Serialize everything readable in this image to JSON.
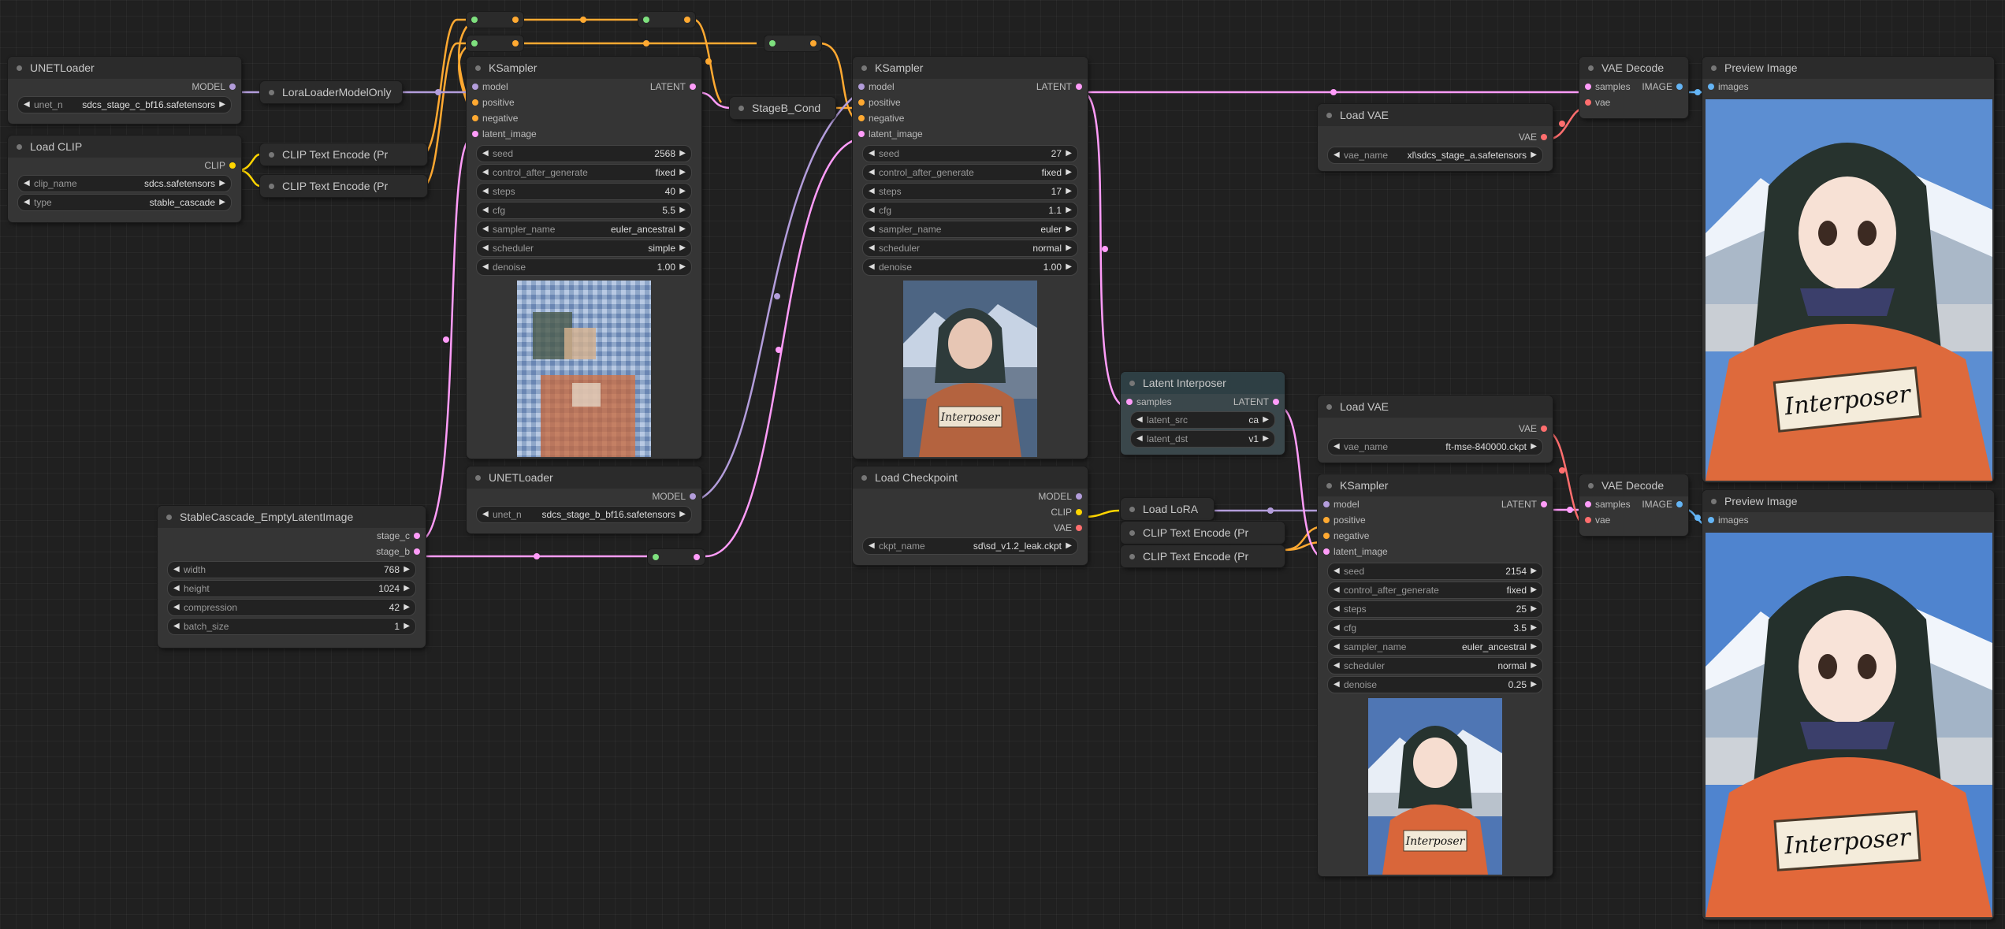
{
  "colors": {
    "model": "#b39ddb",
    "clip": "#ffd500",
    "conditioning": "#ffa931",
    "latent": "#ff9cf9",
    "vae": "#ff6e6e",
    "image": "#64b5f6",
    "float": "#aaaaaa"
  },
  "nodes": {
    "unet1": {
      "title": "UNETLoader",
      "out_model": "MODEL",
      "w_unet_label": "unet_n",
      "w_unet_value": "sdcs_stage_c_bf16.safetensors"
    },
    "loadclip": {
      "title": "Load CLIP",
      "out_clip": "CLIP",
      "w_clip_label": "clip_name",
      "w_clip_value": "sdcs.safetensors",
      "w_type_label": "type",
      "w_type_value": "stable_cascade"
    },
    "lora_model_only": {
      "title": "LoraLoaderModelOnly"
    },
    "clip_enc1": {
      "title": "CLIP Text Encode (Pr"
    },
    "clip_enc2": {
      "title": "CLIP Text Encode (Pr"
    },
    "ks1": {
      "title": "KSampler",
      "in": [
        "model",
        "positive",
        "negative",
        "latent_image"
      ],
      "out_latent": "LATENT",
      "widgets": [
        {
          "label": "seed",
          "value": "2568"
        },
        {
          "label": "control_after_generate",
          "value": "fixed"
        },
        {
          "label": "steps",
          "value": "40"
        },
        {
          "label": "cfg",
          "value": "5.5"
        },
        {
          "label": "sampler_name",
          "value": "euler_ancestral"
        },
        {
          "label": "scheduler",
          "value": "simple"
        },
        {
          "label": "denoise",
          "value": "1.00"
        }
      ]
    },
    "stageb_cond": {
      "title": "StageB_Cond"
    },
    "ks2": {
      "title": "KSampler",
      "in": [
        "model",
        "positive",
        "negative",
        "latent_image"
      ],
      "out_latent": "LATENT",
      "widgets": [
        {
          "label": "seed",
          "value": "27"
        },
        {
          "label": "control_after_generate",
          "value": "fixed"
        },
        {
          "label": "steps",
          "value": "17"
        },
        {
          "label": "cfg",
          "value": "1.1"
        },
        {
          "label": "sampler_name",
          "value": "euler"
        },
        {
          "label": "scheduler",
          "value": "normal"
        },
        {
          "label": "denoise",
          "value": "1.00"
        }
      ],
      "preview_caption": "Interposer"
    },
    "unet2": {
      "title": "UNETLoader",
      "out_model": "MODEL",
      "w_unet_label": "unet_n",
      "w_unet_value": "sdcs_stage_b_bf16.safetensors"
    },
    "empty_latent": {
      "title": "StableCascade_EmptyLatentImage",
      "out_c": "stage_c",
      "out_b": "stage_b",
      "widgets": [
        {
          "label": "width",
          "value": "768"
        },
        {
          "label": "height",
          "value": "1024"
        },
        {
          "label": "compression",
          "value": "42"
        },
        {
          "label": "batch_size",
          "value": "1"
        }
      ]
    },
    "latent_interposer": {
      "title": "Latent Interposer",
      "in_samples": "samples",
      "out_latent": "LATENT",
      "widgets": [
        {
          "label": "latent_src",
          "value": "ca"
        },
        {
          "label": "latent_dst",
          "value": "v1"
        }
      ]
    },
    "load_checkpoint": {
      "title": "Load Checkpoint",
      "out_model": "MODEL",
      "out_clip": "CLIP",
      "out_vae": "VAE",
      "w_ckpt_label": "ckpt_name",
      "w_ckpt_value": "sd\\sd_v1.2_leak.ckpt"
    },
    "load_lora": {
      "title": "Load LoRA"
    },
    "clip_enc3": {
      "title": "CLIP Text Encode (Pr"
    },
    "clip_enc4": {
      "title": "CLIP Text Encode (Pr"
    },
    "ks3": {
      "title": "KSampler",
      "in": [
        "model",
        "positive",
        "negative",
        "latent_image"
      ],
      "out_latent": "LATENT",
      "widgets": [
        {
          "label": "seed",
          "value": "2154"
        },
        {
          "label": "control_after_generate",
          "value": "fixed"
        },
        {
          "label": "steps",
          "value": "25"
        },
        {
          "label": "cfg",
          "value": "3.5"
        },
        {
          "label": "sampler_name",
          "value": "euler_ancestral"
        },
        {
          "label": "scheduler",
          "value": "normal"
        },
        {
          "label": "denoise",
          "value": "0.25"
        }
      ],
      "preview_caption": "Interposer"
    },
    "load_vae1": {
      "title": "Load VAE",
      "out_vae": "VAE",
      "w_label": "vae_name",
      "w_value": "xl\\sdcs_stage_a.safetensors"
    },
    "load_vae2": {
      "title": "Load VAE",
      "out_vae": "VAE",
      "w_label": "vae_name",
      "w_value": "ft-mse-840000.ckpt"
    },
    "vae_decode1": {
      "title": "VAE Decode",
      "in_samples": "samples",
      "in_vae": "vae",
      "out_image": "IMAGE"
    },
    "vae_decode2": {
      "title": "VAE Decode",
      "in_samples": "samples",
      "in_vae": "vae",
      "out_image": "IMAGE"
    },
    "preview1": {
      "title": "Preview Image",
      "in_images": "images",
      "caption": "Interposer"
    },
    "preview2": {
      "title": "Preview Image",
      "in_images": "images",
      "caption": "Interposer"
    }
  }
}
